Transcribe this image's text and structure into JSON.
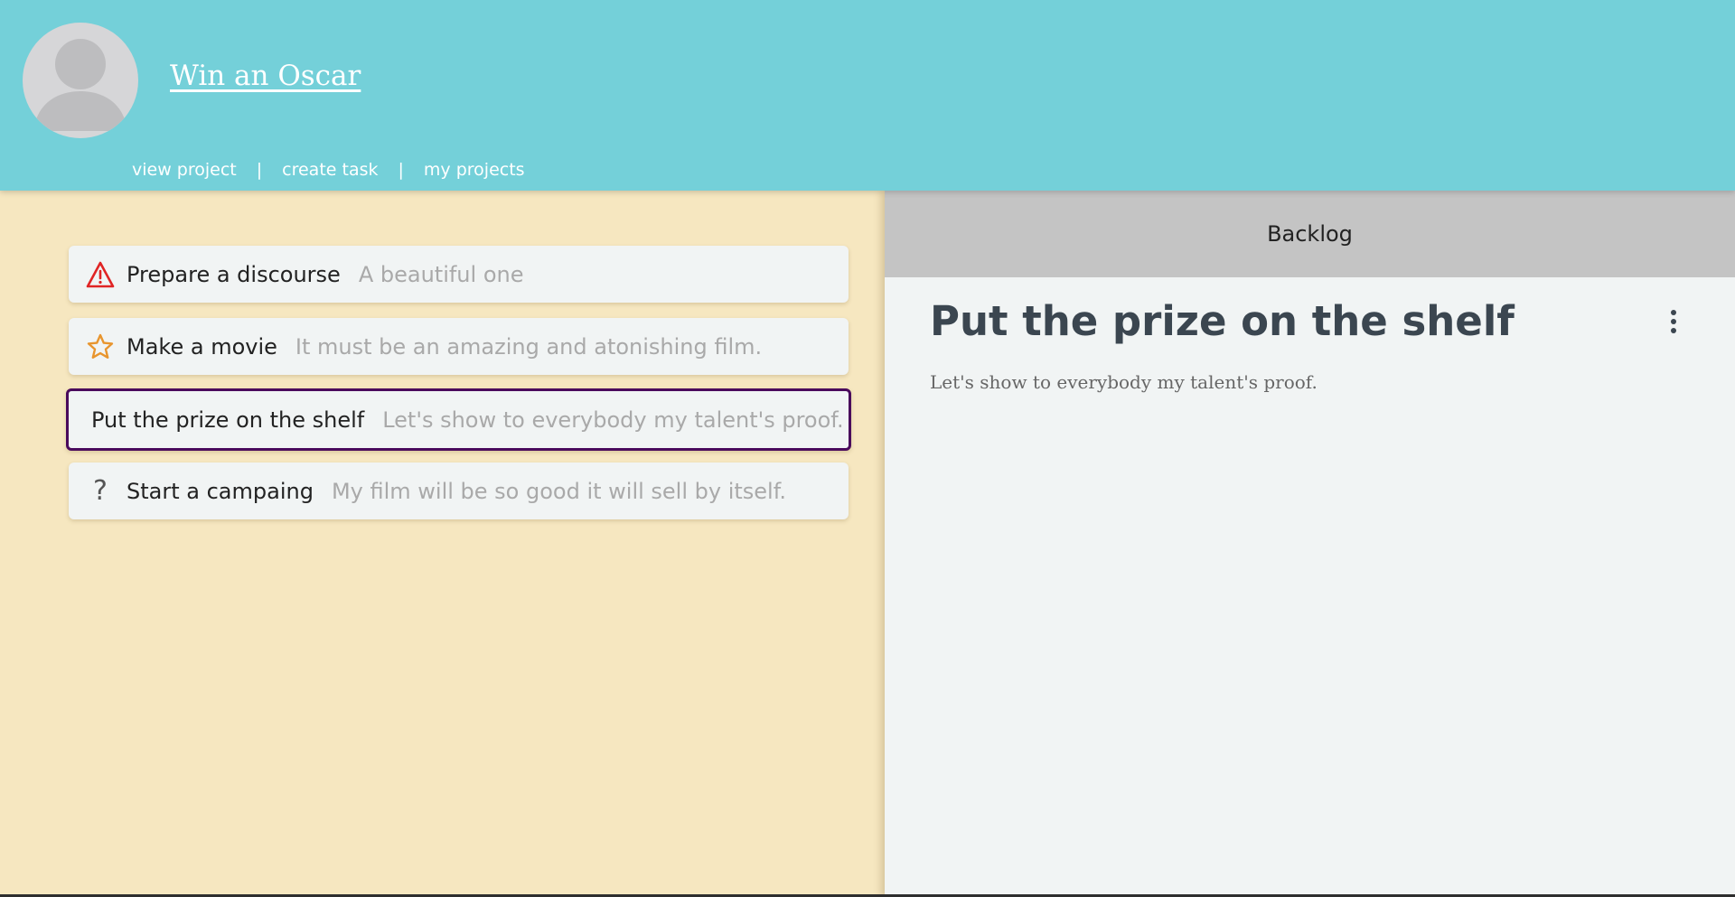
{
  "header": {
    "project_title": "Win an Oscar",
    "nav": {
      "view_project": "view project",
      "separator_1": "|",
      "create_task": "create task",
      "separator_2": "|",
      "my_projects": "my projects"
    }
  },
  "tasks": [
    {
      "icon": "warning-icon",
      "title": "Prepare a discourse",
      "description": "A beautiful one",
      "icon_color": "#e02424"
    },
    {
      "icon": "star-icon",
      "title": "Make a movie",
      "description": "It must be an amazing and atonishing film.",
      "icon_color": "#e8952e"
    },
    {
      "icon": "",
      "title": "Put the prize on the shelf",
      "description": "Let's show to everybody my talent's proof.",
      "selected": true
    },
    {
      "icon": "question-icon",
      "title": "Start a campaing",
      "description": "My film will be so good it will sell by itself.",
      "icon_glyph": "?"
    }
  ],
  "detail": {
    "column": "Backlog",
    "title": "Put the prize on the shelf",
    "description": "Let's show to everybody my talent's proof."
  },
  "colors": {
    "header_bg": "#74d0d9",
    "left_bg": "#f6e7c0",
    "card_bg": "#f1f4f4",
    "selected_border": "#4a0a5c",
    "column_header_bg": "#c4c4c4"
  }
}
